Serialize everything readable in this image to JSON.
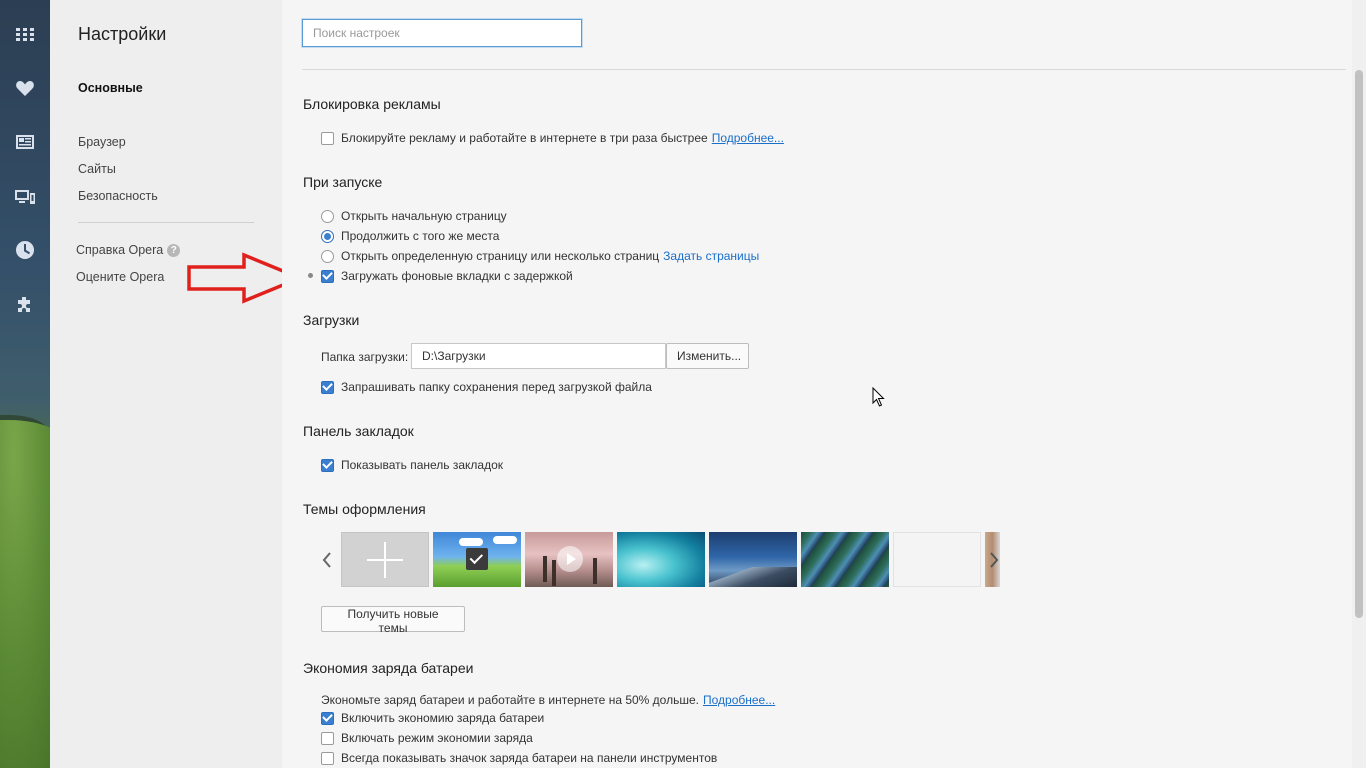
{
  "nav": {
    "title": "Настройки",
    "items": [
      "Основные",
      "Браузер",
      "Сайты",
      "Безопасность"
    ],
    "help_label": "Справка Opera",
    "help_badge": "?",
    "rate_label": "Оцените Opera"
  },
  "search": {
    "placeholder": "Поиск настроек"
  },
  "adblock": {
    "title": "Блокировка рекламы",
    "label": "Блокируйте рекламу и работайте в интернете в три раза быстрее",
    "link": "Подробнее...",
    "checked": false
  },
  "startup": {
    "title": "При запуске",
    "options": [
      {
        "label": "Открыть начальную страницу",
        "selected": false
      },
      {
        "label": "Продолжить с того же места",
        "selected": true
      },
      {
        "label": "Открыть определенную страницу или несколько страниц",
        "selected": false,
        "link": "Задать страницы"
      }
    ],
    "delay_label": "Загружать фоновые вкладки с задержкой",
    "delay_checked": true
  },
  "downloads": {
    "title": "Загрузки",
    "folder_label": "Папка загрузки:",
    "folder_value": "D:\\Загрузки",
    "change_button": "Изменить...",
    "ask_label": "Запрашивать папку сохранения перед загрузкой файла",
    "ask_checked": true
  },
  "bookmarks": {
    "title": "Панель закладок",
    "show_label": "Показывать панель закладок",
    "show_checked": true
  },
  "themes": {
    "title": "Темы оформления",
    "get_button": "Получить новые темы"
  },
  "battery": {
    "title": "Экономия заряда батареи",
    "description": "Экономьте заряд батареи и работайте в интернете на 50% дольше.",
    "link": "Подробнее...",
    "options": [
      {
        "label": "Включить экономию заряда батареи",
        "checked": true
      },
      {
        "label": "Включать режим экономии заряда",
        "checked": false
      },
      {
        "label": "Всегда показывать значок заряда батареи на панели инструментов",
        "checked": false
      }
    ]
  },
  "colors": {
    "accent": "#3a7fd0",
    "link": "#1a6fc9",
    "annotation": "#e0201c"
  },
  "icons": [
    "speed-dial-icon",
    "heart-icon",
    "news-icon",
    "devices-icon",
    "history-icon",
    "extensions-icon"
  ]
}
